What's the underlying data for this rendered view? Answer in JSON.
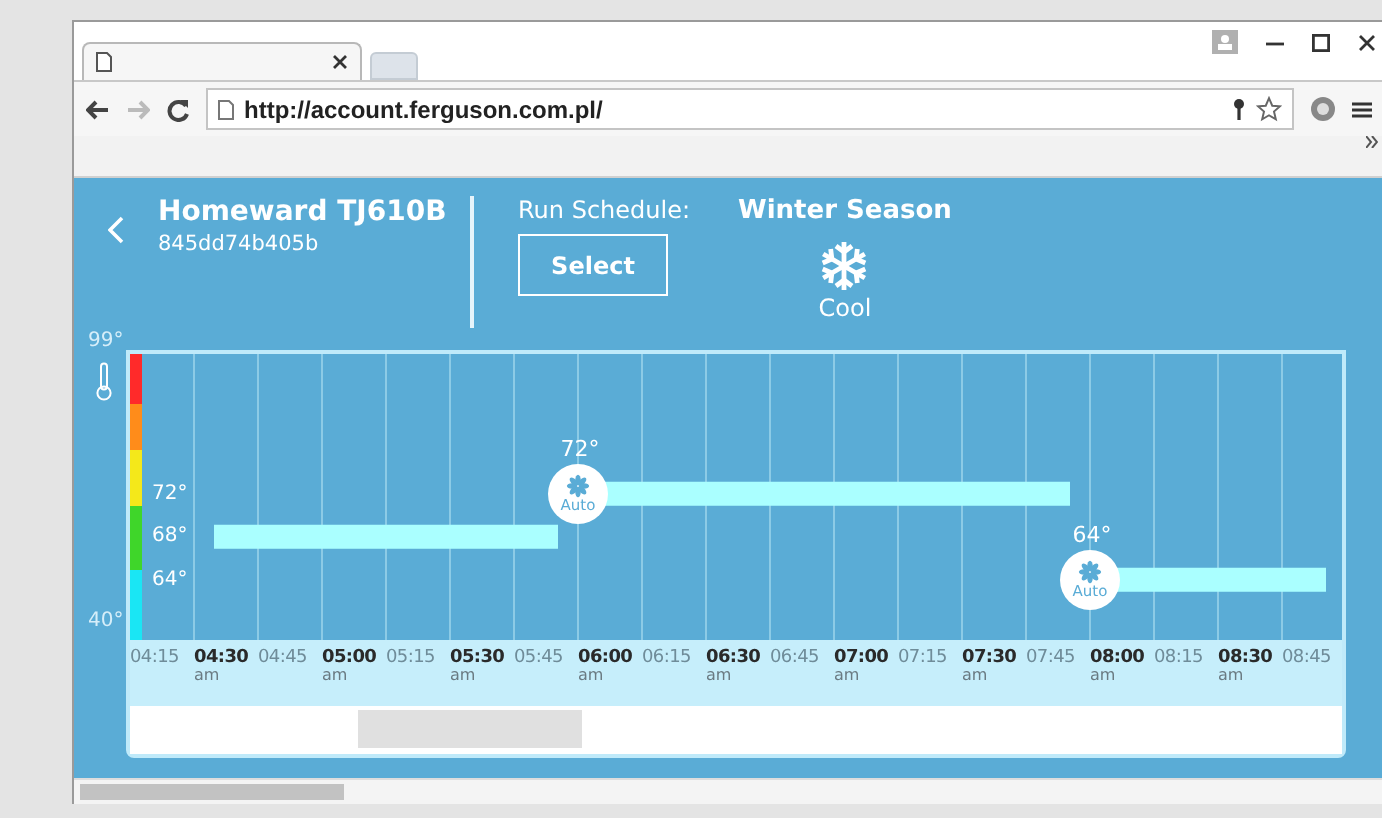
{
  "browser": {
    "url": "http://account.ferguson.com.pl/"
  },
  "device": {
    "name": "Homeward TJ610B",
    "id": "845dd74b405b"
  },
  "schedule": {
    "label": "Run Schedule:",
    "button": "Select",
    "season": "Winter Season",
    "mode": "Cool"
  },
  "scale": {
    "max": "99°",
    "min": "40°"
  },
  "chart_data": {
    "type": "line",
    "categories": [
      "04:15",
      "04:30",
      "04:45",
      "05:00",
      "05:15",
      "05:30",
      "05:45",
      "06:00",
      "06:15",
      "06:30",
      "06:45",
      "07:00",
      "07:15",
      "07:30",
      "07:45",
      "08:00",
      "08:15",
      "08:30",
      "08:45"
    ],
    "series": [
      {
        "color": "#aaffff",
        "values": [
          null,
          68,
          68,
          68,
          68,
          68,
          68,
          72,
          72,
          72,
          72,
          72,
          72,
          72,
          72,
          64,
          64,
          64,
          64
        ]
      }
    ],
    "ylim": [
      47.4,
      85
    ],
    "yticks": [
      {
        "value": 72,
        "label": "72°"
      },
      {
        "value": 68,
        "label": "68°"
      },
      {
        "value": 64,
        "label": "64°"
      }
    ]
  },
  "time_axis": [
    {
      "kind": "minor"
    },
    {
      "kind": "major",
      "period": "am"
    },
    {
      "kind": "minor"
    },
    {
      "kind": "major",
      "period": "am"
    },
    {
      "kind": "minor"
    },
    {
      "kind": "major",
      "period": "am"
    },
    {
      "kind": "minor"
    },
    {
      "kind": "major",
      "period": "am"
    },
    {
      "kind": "minor"
    },
    {
      "kind": "major",
      "period": "am"
    },
    {
      "kind": "minor"
    },
    {
      "kind": "major",
      "period": "am"
    },
    {
      "kind": "minor"
    },
    {
      "kind": "major",
      "period": "am"
    },
    {
      "kind": "minor"
    },
    {
      "kind": "major",
      "period": "am"
    },
    {
      "kind": "minor"
    },
    {
      "kind": "major",
      "period": "am"
    },
    {
      "kind": "minor"
    }
  ],
  "markers": [
    {
      "temp": "72°",
      "mode": "Auto"
    },
    {
      "temp": "64°",
      "mode": "Auto"
    }
  ]
}
